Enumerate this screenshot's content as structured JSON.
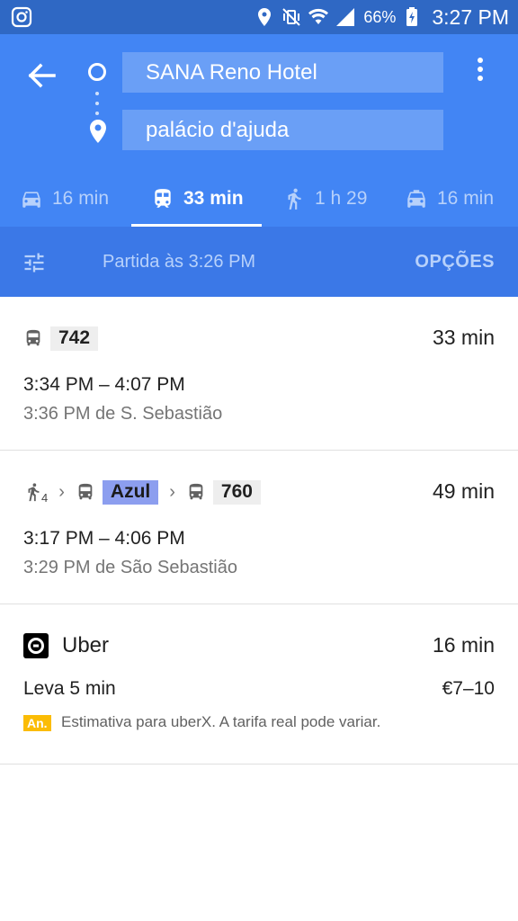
{
  "status_bar": {
    "battery_percent": "66%",
    "time": "3:27 PM",
    "icons": [
      "instagram-icon",
      "location-icon",
      "vibrate-off-icon",
      "wifi-icon",
      "signal-icon",
      "battery-charging-icon"
    ]
  },
  "header": {
    "origin": "SANA Reno Hotel",
    "destination": "palácio d'ajuda",
    "modes": [
      {
        "icon": "car-icon",
        "label": "16 min",
        "active": false
      },
      {
        "icon": "transit-icon",
        "label": "33 min",
        "active": true
      },
      {
        "icon": "walk-icon",
        "label": "1 h 29",
        "active": false
      },
      {
        "icon": "taxi-icon",
        "label": "16 min",
        "active": false
      }
    ],
    "departure": "Partida às 3:26 PM",
    "options_label": "OPÇÕES"
  },
  "routes": [
    {
      "line": "742",
      "duration": "33 min",
      "times": "3:34 PM – 4:07 PM",
      "from": "3:36 PM de S. Sebastião"
    },
    {
      "walk_minutes": "4",
      "line_a": "Azul",
      "line_b": "760",
      "duration": "49 min",
      "times": "3:17 PM – 4:06 PM",
      "from": "3:29 PM de São Sebastião"
    }
  ],
  "uber": {
    "name": "Uber",
    "duration": "16 min",
    "wait": "Leva 5 min",
    "price": "€7–10",
    "ad_badge": "An.",
    "note": "Estimativa para uberX. A tarifa real pode variar."
  },
  "colors": {
    "header_blue": "#4285f4",
    "status_blue": "#2f68c4",
    "options_blue": "#3b78e7",
    "azul_chip": "#8c9eef",
    "ad_yellow": "#fbbc05"
  }
}
